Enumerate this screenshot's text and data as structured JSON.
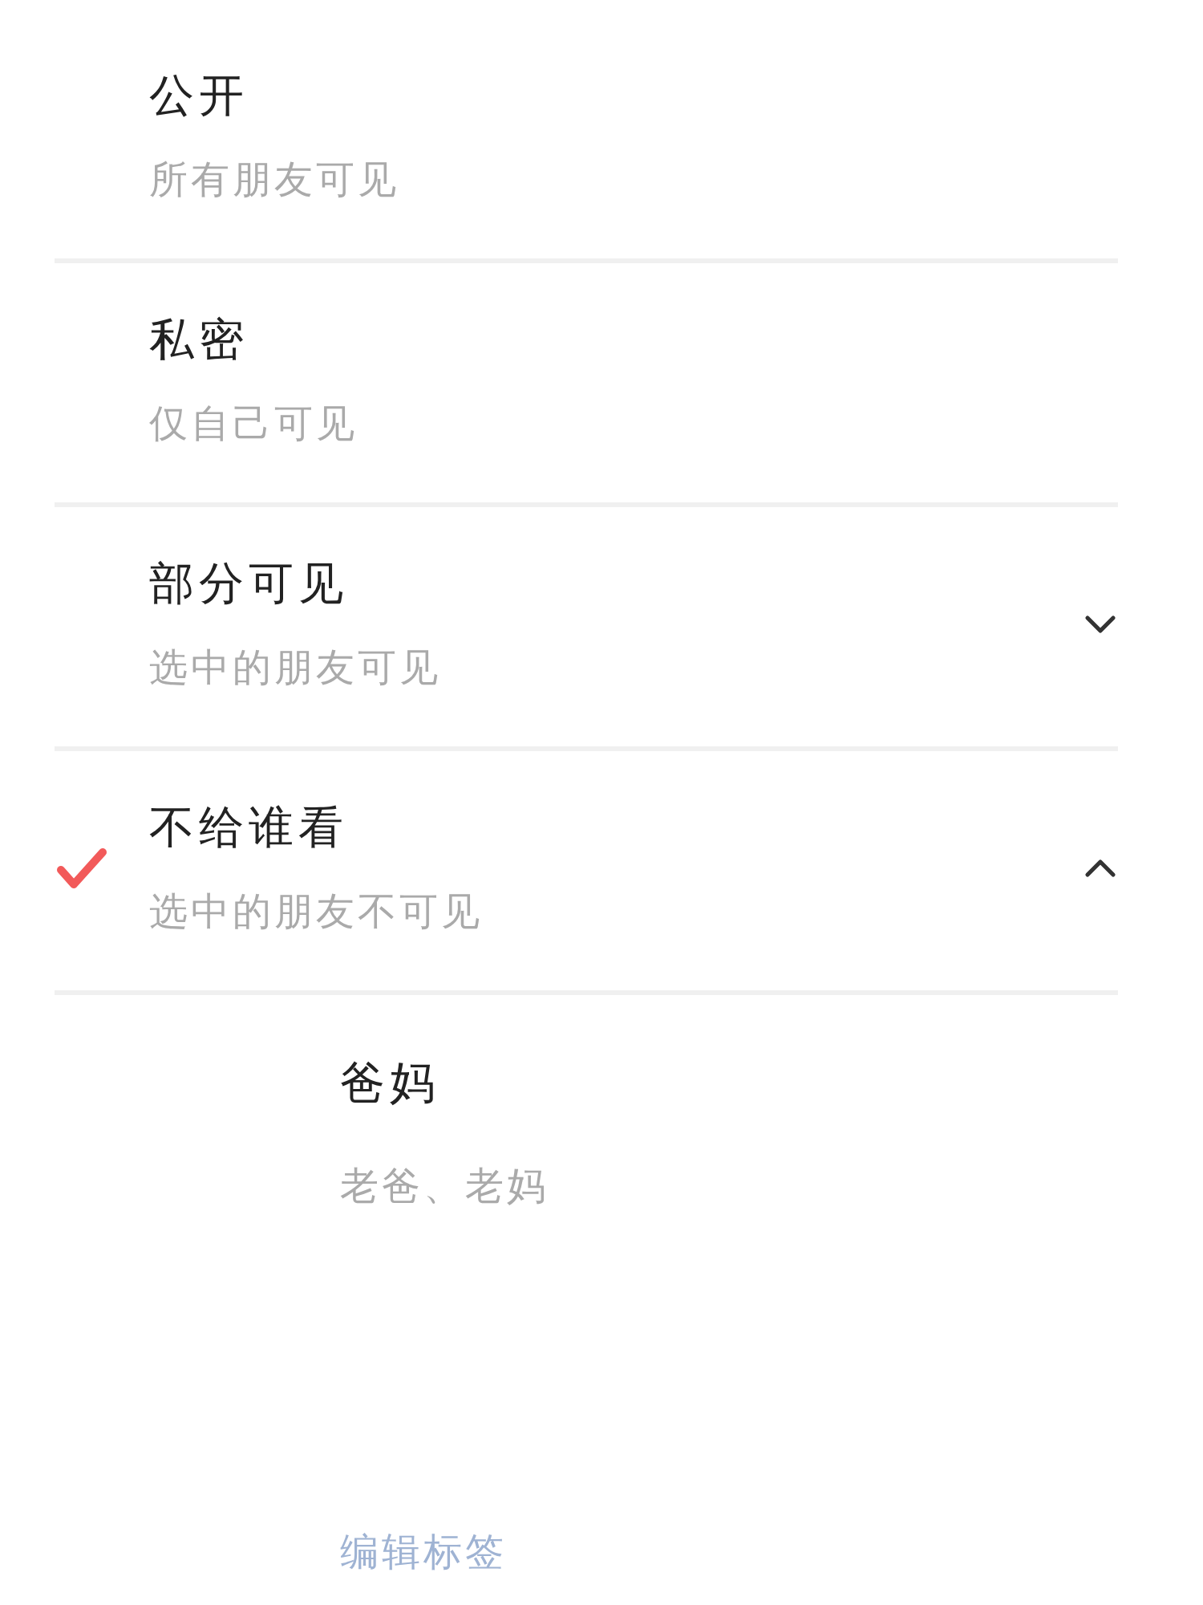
{
  "options": [
    {
      "title": "公开",
      "subtitle": "所有朋友可见",
      "selected": false,
      "expandable": false
    },
    {
      "title": "私密",
      "subtitle": "仅自己可见",
      "selected": false,
      "expandable": false
    },
    {
      "title": "部分可见",
      "subtitle": "选中的朋友可见",
      "selected": false,
      "expandable": true,
      "expanded": false
    },
    {
      "title": "不给谁看",
      "subtitle": "选中的朋友不可见",
      "selected": true,
      "expandable": true,
      "expanded": true,
      "tags": [
        {
          "name": "爸妈",
          "members": "老爸、老妈"
        }
      ],
      "edit_link": "编辑标签"
    }
  ]
}
